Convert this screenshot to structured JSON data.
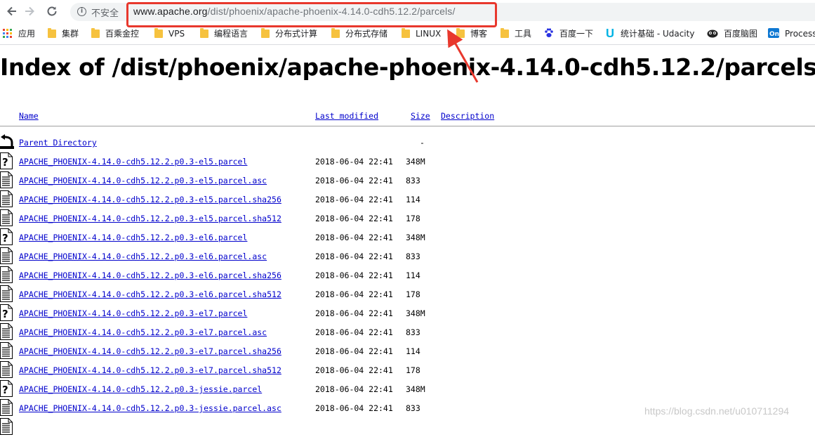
{
  "browser": {
    "security_label": "不安全",
    "url_host": "www.apache.org",
    "url_path": "/dist/phoenix/apache-phoenix-4.14.0-cdh5.12.2/parcels/"
  },
  "bookmarks": [
    {
      "label": "应用",
      "icon": "apps-grid-icon"
    },
    {
      "label": "集群",
      "icon": "folder-icon"
    },
    {
      "label": "百乘金控",
      "icon": "folder-icon"
    },
    {
      "label": "VPS",
      "icon": "folder-icon"
    },
    {
      "label": "编程语言",
      "icon": "folder-icon"
    },
    {
      "label": "分布式计算",
      "icon": "folder-icon"
    },
    {
      "label": "分布式存储",
      "icon": "folder-icon"
    },
    {
      "label": "LINUX",
      "icon": "folder-icon"
    },
    {
      "label": "博客",
      "icon": "folder-icon"
    },
    {
      "label": "工具",
      "icon": "folder-icon"
    },
    {
      "label": "百度一下",
      "icon": "baidu-paw-icon"
    },
    {
      "label": "统计基础 - Udacity",
      "icon": "udacity-icon"
    },
    {
      "label": "百度脑图",
      "icon": "baidu-naotu-icon"
    },
    {
      "label": "Process",
      "icon": "processon-icon"
    }
  ],
  "page": {
    "title": "Index of /dist/phoenix/apache-phoenix-4.14.0-cdh5.12.2/parcels",
    "columns": {
      "name": "Name",
      "modified": "Last modified",
      "size": "Size",
      "description": "Description"
    },
    "parent": {
      "name": "Parent Directory",
      "modified": "",
      "size": "-"
    },
    "files": [
      {
        "name": "APACHE_PHOENIX-4.14.0-cdh5.12.2.p0.3-el5.parcel",
        "modified": "2018-06-04 22:41",
        "size": "348M",
        "icon": "unknown-file-icon"
      },
      {
        "name": "APACHE_PHOENIX-4.14.0-cdh5.12.2.p0.3-el5.parcel.asc",
        "modified": "2018-06-04 22:41",
        "size": "833",
        "icon": "text-file-icon"
      },
      {
        "name": "APACHE_PHOENIX-4.14.0-cdh5.12.2.p0.3-el5.parcel.sha256",
        "modified": "2018-06-04 22:41",
        "size": "114",
        "icon": "text-file-icon"
      },
      {
        "name": "APACHE_PHOENIX-4.14.0-cdh5.12.2.p0.3-el5.parcel.sha512",
        "modified": "2018-06-04 22:41",
        "size": "178",
        "icon": "text-file-icon"
      },
      {
        "name": "APACHE_PHOENIX-4.14.0-cdh5.12.2.p0.3-el6.parcel",
        "modified": "2018-06-04 22:41",
        "size": "348M",
        "icon": "unknown-file-icon"
      },
      {
        "name": "APACHE_PHOENIX-4.14.0-cdh5.12.2.p0.3-el6.parcel.asc",
        "modified": "2018-06-04 22:41",
        "size": "833",
        "icon": "text-file-icon"
      },
      {
        "name": "APACHE_PHOENIX-4.14.0-cdh5.12.2.p0.3-el6.parcel.sha256",
        "modified": "2018-06-04 22:41",
        "size": "114",
        "icon": "text-file-icon"
      },
      {
        "name": "APACHE_PHOENIX-4.14.0-cdh5.12.2.p0.3-el6.parcel.sha512",
        "modified": "2018-06-04 22:41",
        "size": "178",
        "icon": "text-file-icon"
      },
      {
        "name": "APACHE_PHOENIX-4.14.0-cdh5.12.2.p0.3-el7.parcel",
        "modified": "2018-06-04 22:41",
        "size": "348M",
        "icon": "unknown-file-icon"
      },
      {
        "name": "APACHE_PHOENIX-4.14.0-cdh5.12.2.p0.3-el7.parcel.asc",
        "modified": "2018-06-04 22:41",
        "size": "833",
        "icon": "text-file-icon"
      },
      {
        "name": "APACHE_PHOENIX-4.14.0-cdh5.12.2.p0.3-el7.parcel.sha256",
        "modified": "2018-06-04 22:41",
        "size": "114",
        "icon": "text-file-icon"
      },
      {
        "name": "APACHE_PHOENIX-4.14.0-cdh5.12.2.p0.3-el7.parcel.sha512",
        "modified": "2018-06-04 22:41",
        "size": "178",
        "icon": "text-file-icon"
      },
      {
        "name": "APACHE_PHOENIX-4.14.0-cdh5.12.2.p0.3-jessie.parcel",
        "modified": "2018-06-04 22:41",
        "size": "348M",
        "icon": "unknown-file-icon"
      },
      {
        "name": "APACHE_PHOENIX-4.14.0-cdh5.12.2.p0.3-jessie.parcel.asc",
        "modified": "2018-06-04 22:41",
        "size": "833",
        "icon": "text-file-icon"
      },
      {
        "name": "",
        "modified": "",
        "size": "",
        "icon": "text-file-icon"
      }
    ]
  },
  "watermark": "https://blog.csdn.net/u010711294",
  "colors": {
    "link": "#0000cc",
    "annotation": "#e8382d",
    "folder": "#f6c23f"
  }
}
